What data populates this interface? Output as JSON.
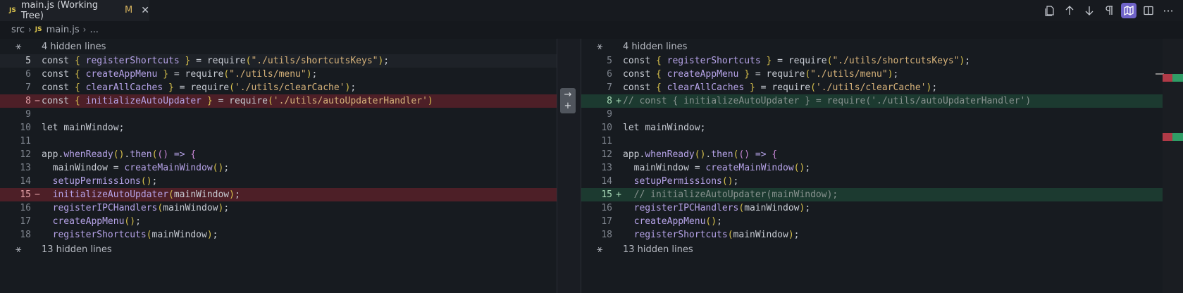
{
  "tab": {
    "language_badge": "JS",
    "title": "main.js (Working Tree)",
    "modified": "M",
    "close": "✕"
  },
  "toolbar": {
    "icons": [
      "open-file-icon",
      "arrow-up-icon",
      "arrow-down-icon",
      "pilcrow-icon",
      "map-icon",
      "split-editor-icon",
      "more-icon"
    ],
    "more": "···"
  },
  "breadcrumb": {
    "folder": "src",
    "language_badge": "JS",
    "file": "main.js",
    "ellipsis": "..."
  },
  "revert": {
    "arrow": "→",
    "plus": "+"
  },
  "left": {
    "hidden_top": "4 hidden lines",
    "hidden_bottom": "13 hidden lines",
    "lines": [
      {
        "n": "5",
        "marker": "",
        "text": "const { registerShortcuts } = require(\"./utils/shortcutsKeys\");"
      },
      {
        "n": "6",
        "marker": "",
        "text": "const { createAppMenu } = require(\"./utils/menu\");"
      },
      {
        "n": "7",
        "marker": "",
        "text": "const { clearAllCaches } = require('./utils/clearCache');"
      },
      {
        "n": "8",
        "marker": "−",
        "text": "const { initializeAutoUpdater } = require('./utils/autoUpdaterHandler')"
      },
      {
        "n": "9",
        "marker": "",
        "text": ""
      },
      {
        "n": "10",
        "marker": "",
        "text": "let mainWindow;"
      },
      {
        "n": "11",
        "marker": "",
        "text": ""
      },
      {
        "n": "12",
        "marker": "",
        "text": "app.whenReady().then(() => {"
      },
      {
        "n": "13",
        "marker": "",
        "text": "  mainWindow = createMainWindow();"
      },
      {
        "n": "14",
        "marker": "",
        "text": "  setupPermissions();"
      },
      {
        "n": "15",
        "marker": "−",
        "text": "  initializeAutoUpdater(mainWindow);"
      },
      {
        "n": "16",
        "marker": "",
        "text": "  registerIPCHandlers(mainWindow);"
      },
      {
        "n": "17",
        "marker": "",
        "text": "  createAppMenu();"
      },
      {
        "n": "18",
        "marker": "",
        "text": "  registerShortcuts(mainWindow);"
      }
    ]
  },
  "right": {
    "hidden_top": "4 hidden lines",
    "hidden_bottom": "13 hidden lines",
    "lines": [
      {
        "n": "5",
        "marker": "",
        "text": "const { registerShortcuts } = require(\"./utils/shortcutsKeys\");"
      },
      {
        "n": "6",
        "marker": "",
        "text": "const { createAppMenu } = require(\"./utils/menu\");"
      },
      {
        "n": "7",
        "marker": "",
        "text": "const { clearAllCaches } = require('./utils/clearCache');"
      },
      {
        "n": "8",
        "marker": "+",
        "text": "// const { initializeAutoUpdater } = require('./utils/autoUpdaterHandler')"
      },
      {
        "n": "9",
        "marker": "",
        "text": ""
      },
      {
        "n": "10",
        "marker": "",
        "text": "let mainWindow;"
      },
      {
        "n": "11",
        "marker": "",
        "text": ""
      },
      {
        "n": "12",
        "marker": "",
        "text": "app.whenReady().then(() => {"
      },
      {
        "n": "13",
        "marker": "",
        "text": "  mainWindow = createMainWindow();"
      },
      {
        "n": "14",
        "marker": "",
        "text": "  setupPermissions();"
      },
      {
        "n": "15",
        "marker": "+",
        "text": "  // initializeAutoUpdater(mainWindow);"
      },
      {
        "n": "16",
        "marker": "",
        "text": "  registerIPCHandlers(mainWindow);"
      },
      {
        "n": "17",
        "marker": "",
        "text": "  createAppMenu();"
      },
      {
        "n": "18",
        "marker": "",
        "text": "  registerShortcuts(mainWindow);"
      }
    ]
  },
  "colors": {
    "deleted_line": "#4d1f27",
    "inserted_line": "#1c3a30",
    "accent_active": "#6f63c8",
    "minimap_deleted": "#b03a47",
    "minimap_inserted": "#2f9d66"
  }
}
